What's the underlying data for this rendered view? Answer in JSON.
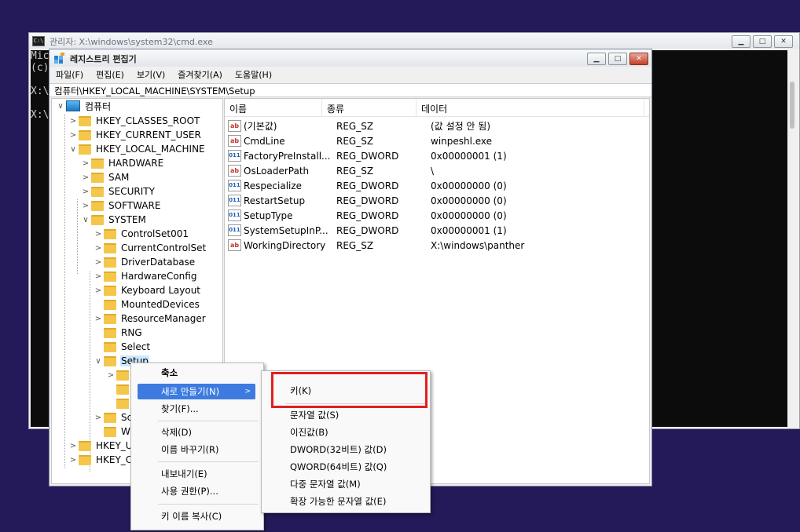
{
  "cmd": {
    "title": "관리자: X:\\windows\\system32\\cmd.exe",
    "icon_text": "C:\\",
    "lines": [
      "Mic",
      "(c)",
      "",
      "X:\\",
      "",
      "X:\\"
    ]
  },
  "regedit": {
    "title": "레지스트리 편집기",
    "menu": [
      "파일(F)",
      "편집(E)",
      "보기(V)",
      "즐겨찾기(A)",
      "도움말(H)"
    ],
    "address": "컴퓨터\\HKEY_LOCAL_MACHINE\\SYSTEM\\Setup",
    "tree": {
      "root": "컴퓨터",
      "hives": [
        "HKEY_CLASSES_ROOT",
        "HKEY_CURRENT_USER",
        "HKEY_LOCAL_MACHINE"
      ],
      "hklm_children": [
        "HARDWARE",
        "SAM",
        "SECURITY",
        "SOFTWARE",
        "SYSTEM"
      ],
      "system_children": [
        "ControlSet001",
        "CurrentControlSet",
        "DriverDatabase",
        "HardwareConfig",
        "Keyboard Layout",
        "MountedDevices",
        "ResourceManager",
        "RNG",
        "Select",
        "Setup"
      ],
      "partial_children": [
        "Sc",
        "W"
      ],
      "tail_hives": [
        "HKEY_U",
        "HKEY_C"
      ]
    },
    "columns": [
      "이름",
      "종류",
      "데이터"
    ],
    "values": [
      {
        "icon": "ab",
        "name": "(기본값)",
        "type": "REG_SZ",
        "data": "(값 설정 안 됨)"
      },
      {
        "icon": "ab",
        "name": "CmdLine",
        "type": "REG_SZ",
        "data": "winpeshl.exe"
      },
      {
        "icon": "011",
        "name": "FactoryPreInstall...",
        "type": "REG_DWORD",
        "data": "0x00000001 (1)"
      },
      {
        "icon": "ab",
        "name": "OsLoaderPath",
        "type": "REG_SZ",
        "data": "\\"
      },
      {
        "icon": "011",
        "name": "Respecialize",
        "type": "REG_DWORD",
        "data": "0x00000000 (0)"
      },
      {
        "icon": "011",
        "name": "RestartSetup",
        "type": "REG_DWORD",
        "data": "0x00000000 (0)"
      },
      {
        "icon": "011",
        "name": "SetupType",
        "type": "REG_DWORD",
        "data": "0x00000000 (0)"
      },
      {
        "icon": "011",
        "name": "SystemSetupInP...",
        "type": "REG_DWORD",
        "data": "0x00000001 (1)"
      },
      {
        "icon": "ab",
        "name": "WorkingDirectory",
        "type": "REG_SZ",
        "data": "X:\\windows\\panther"
      }
    ]
  },
  "context_menu": {
    "collapse": "축소",
    "new": "새로 만들기(N)",
    "find": "찾기(F)...",
    "delete": "삭제(D)",
    "rename": "이름 바꾸기(R)",
    "export": "내보내기(E)",
    "permissions": "사용 권한(P)...",
    "copy_key_name": "키 이름 복사(C)"
  },
  "submenu": {
    "key": "키(K)",
    "string": "문자열 값(S)",
    "binary": "이진값(B)",
    "dword": "DWORD(32비트) 값(D)",
    "qword": "QWORD(64비트) 값(Q)",
    "multi_string": "다중 문자열 값(M)",
    "expand_string": "확장 가능한 문자열 값(E)"
  },
  "colors": {
    "desktop": "#241a5a",
    "highlight": "#3d7be0",
    "annotation_box": "#e02020"
  }
}
